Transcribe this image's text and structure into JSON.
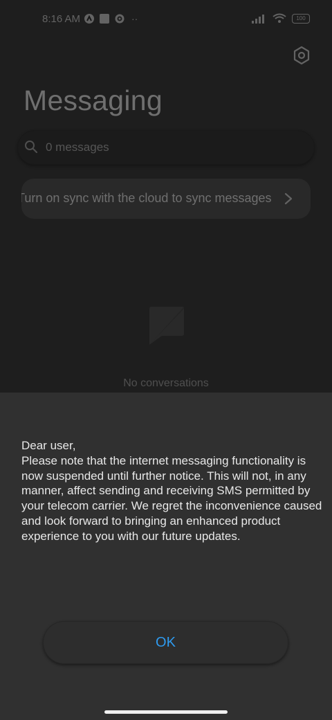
{
  "status_bar": {
    "time": "8:16 AM",
    "battery": "100"
  },
  "header": {
    "title": "Messaging"
  },
  "search": {
    "placeholder": "0 messages"
  },
  "sync_banner": {
    "text": "Turn on sync with the cloud to sync messages"
  },
  "empty_state": {
    "text": "No conversations"
  },
  "dialog": {
    "greeting": "Dear user,",
    "body": "Please note that the internet messaging functionality is now suspended until further notice. This will not, in any manner, affect sending and receiving SMS permitted by your telecom carrier. We regret the inconvenience caused and look forward to bringing an enhanced product experience to you with our future updates.",
    "ok_label": "OK"
  },
  "colors": {
    "accent": "#2e9bf0",
    "sheet": "#303030",
    "background": "#2a2a2a"
  },
  "icons": [
    "settings-icon",
    "search-icon",
    "chevron-right-icon",
    "empty-chat-icon",
    "wifi-icon",
    "signal-icon",
    "battery-icon"
  ]
}
